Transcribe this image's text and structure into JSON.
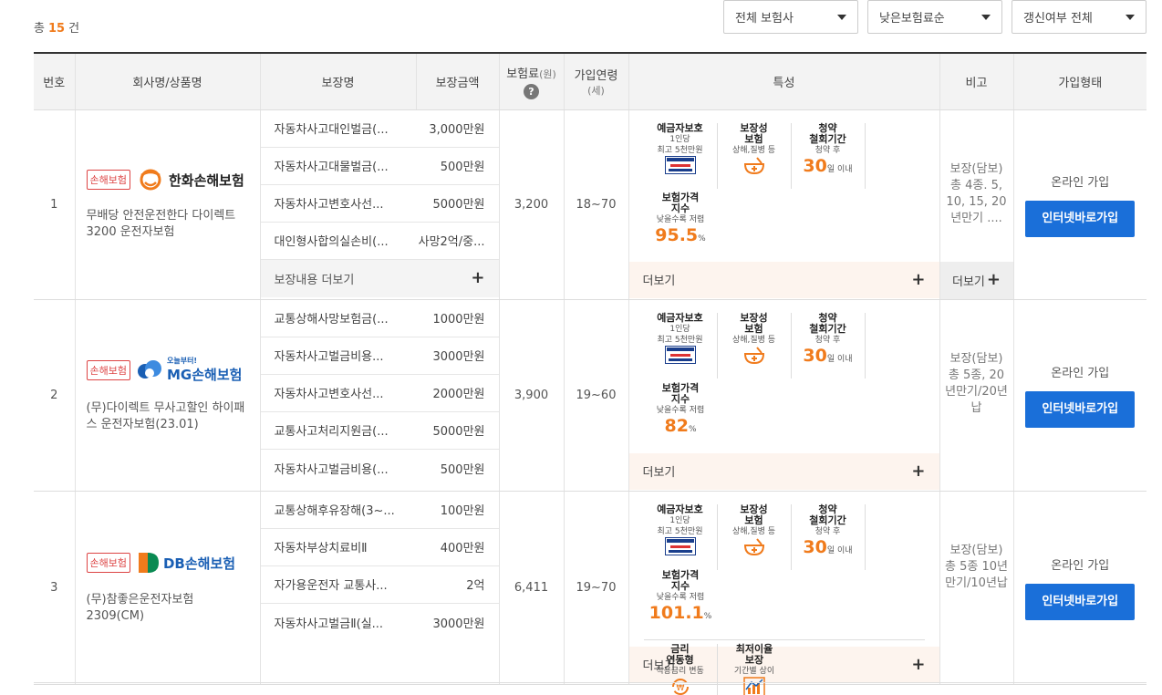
{
  "summary": {
    "prefix": "총",
    "count": "15",
    "suffix": "건"
  },
  "filters": [
    {
      "value": "전체 보험사"
    },
    {
      "value": "낮은보험료순"
    },
    {
      "value": "갱신여부 전체"
    }
  ],
  "columns": {
    "no": "번호",
    "company": "회사명/상품명",
    "coverage": "보장명",
    "amount": "보장금액",
    "premium": "보험료",
    "premium_unit": "(원)",
    "age": "가입연령",
    "age_unit": "(세)",
    "features": "특성",
    "note": "비고",
    "join": "가입형태"
  },
  "feature_labels": {
    "deposit": {
      "title": "예금자보호",
      "sub1": "1인당",
      "sub2": "최고 5천만원"
    },
    "coverage": {
      "title": "보장성\n보험",
      "sub": "상해,질병 등"
    },
    "withdraw": {
      "title": "청약\n철회기간",
      "sub": "청약 후",
      "value": "30",
      "unit": "일 이내"
    },
    "index": {
      "title": "보험가격\n지수",
      "sub": "낮을수록 저렴",
      "unit": "%"
    },
    "rate": {
      "title": "금리\n연동형",
      "sub": "적용금리 변동"
    },
    "min": {
      "title": "최저이율\n보장",
      "sub": "기간별 상이"
    }
  },
  "labels": {
    "coverage_more": "보장내용 더보기",
    "more": "더보기",
    "online": "온라인 가입",
    "button": "인터넷바로가입",
    "tag": "손해보험"
  },
  "rows": [
    {
      "no": "1",
      "logo": "한화손해보험",
      "logo_color": "#f07b1c",
      "product": "무배당 안전운전한다 다이렉트 3200 운전자보험",
      "covers": [
        {
          "name": "자동차사고대인벌금(...",
          "amount": "3,000만원"
        },
        {
          "name": "자동차사고대물벌금(...",
          "amount": "500만원"
        },
        {
          "name": "자동차사고변호사선...",
          "amount": "5000만원"
        },
        {
          "name": "대인형사합의실손비(...",
          "amount": "사망2억/중..."
        }
      ],
      "premium": "3,200",
      "age": "18~70",
      "index": "95.5",
      "note": "보장(담보) 총 4종. 5, 10, 15, 20년만기 ...."
    },
    {
      "no": "2",
      "logo": "MG손해보험",
      "logo_small": "오늘부터!",
      "logo_color": "#1a5fb4",
      "product": "(무)다이렉트 무사고할인 하이패스 운전자보험(23.01)",
      "covers": [
        {
          "name": "교통상해사망보험금(...",
          "amount": "1000만원"
        },
        {
          "name": "자동차사고벌금비용...",
          "amount": "3000만원"
        },
        {
          "name": "자동차사고변호사선...",
          "amount": "2000만원"
        },
        {
          "name": "교통사고처리지원금(...",
          "amount": "5000만원"
        },
        {
          "name": "자동차사고벌금비용(...",
          "amount": "500만원"
        }
      ],
      "premium": "3,900",
      "age": "19~60",
      "index": "82",
      "note": "보장(담보) 총 5종, 20년만기/20년납"
    },
    {
      "no": "3",
      "logo": "DB손해보험",
      "logo_color": "#0a8a52",
      "product": "(무)참좋은운전자보험2309(CM)",
      "covers": [
        {
          "name": "교통상해후유장해(3~...",
          "amount": "100만원"
        },
        {
          "name": "자동차부상치료비Ⅱ",
          "amount": "400만원"
        },
        {
          "name": "자가용운전자 교통사...",
          "amount": "2억"
        },
        {
          "name": "자동차사고벌금Ⅱ(실...",
          "amount": "3000만원"
        }
      ],
      "premium": "6,411",
      "age": "19~70",
      "index": "101.1",
      "note": "보장(담보) 총 5종 10년만기/10년납"
    }
  ]
}
